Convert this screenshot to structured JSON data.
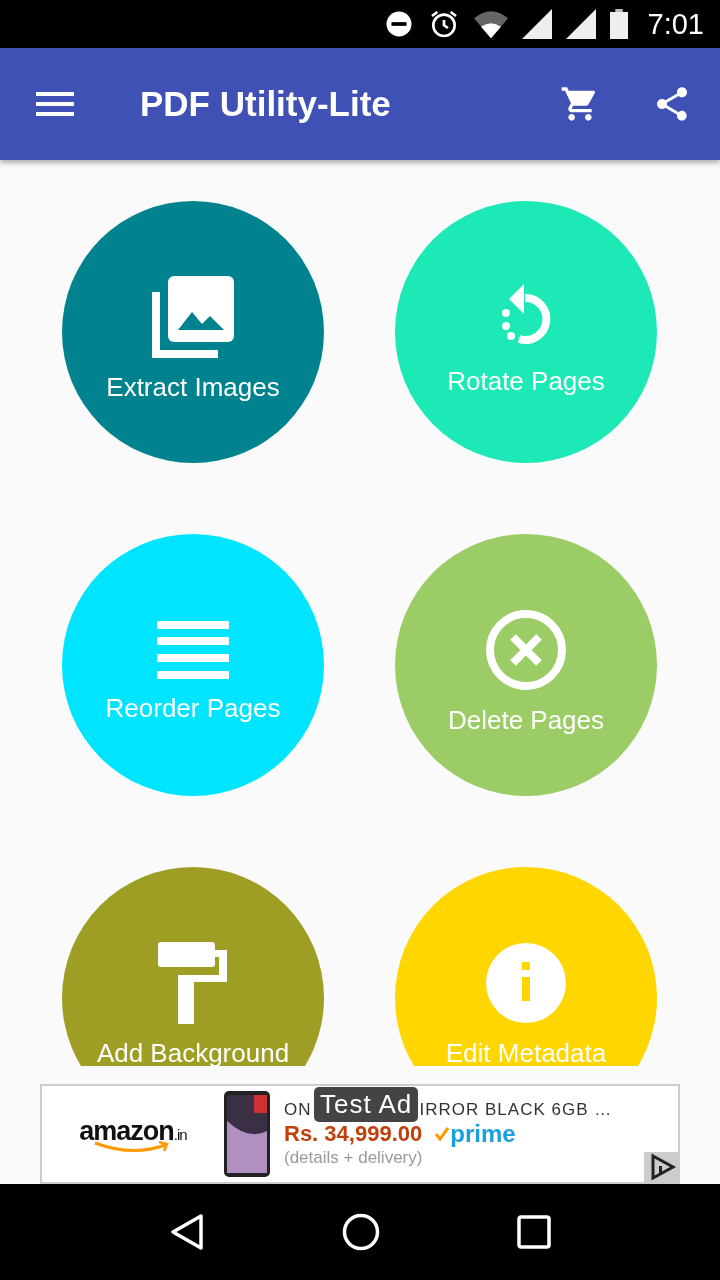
{
  "status_bar": {
    "time": "7:01"
  },
  "app_bar": {
    "title": "PDF Utility-Lite"
  },
  "tiles": [
    {
      "label": "Extract Images",
      "kind": "images",
      "color": "#00838f"
    },
    {
      "label": "Rotate Pages",
      "kind": "rotate",
      "color": "#1de9b6"
    },
    {
      "label": "Reorder Pages",
      "kind": "reorder",
      "color": "#00e5ff"
    },
    {
      "label": "Delete Pages",
      "kind": "delete",
      "color": "#9ccc65"
    },
    {
      "label": "Add Background",
      "kind": "background",
      "color": "#9e9d24"
    },
    {
      "label": "Edit Metadata",
      "kind": "metadata",
      "color": "#ffd600"
    }
  ],
  "ad": {
    "store": "amazon",
    "store_suffix": ".in",
    "title_start": "ON",
    "title_end": "IRROR BLACK 6GB …",
    "badge": "Test Ad",
    "price": "Rs. 34,999.00",
    "prime": "prime",
    "details": "(details + delivery)"
  }
}
